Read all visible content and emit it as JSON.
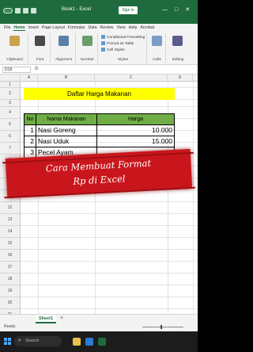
{
  "window": {
    "title": "Book1 - Excel",
    "signin_label": "Sign in",
    "controls": [
      "—",
      "□",
      "✕"
    ]
  },
  "ribbon": {
    "tabs": [
      "File",
      "Home",
      "Insert",
      "Page Layout",
      "Formulas",
      "Data",
      "Review",
      "View",
      "Help",
      "Acrobat"
    ],
    "active_tab": "Home",
    "groups": {
      "clipboard": "Clipboard",
      "font": "Font",
      "alignment": "Alignment",
      "number": "Number",
      "styles": "Styles",
      "cells": "Cells",
      "editing": "Editing"
    },
    "styles_items": [
      "Conditional Formatting",
      "Format as Table",
      "Cell Styles"
    ]
  },
  "formula_bar": {
    "name_box": "D19",
    "fx": "fx",
    "value": ""
  },
  "grid": {
    "columns": [
      "A",
      "B",
      "C",
      "D",
      "E"
    ],
    "rows": [
      "1",
      "2",
      "3",
      "4",
      "5",
      "6",
      "7",
      "8",
      "9",
      "10",
      "11",
      "12",
      "13",
      "14",
      "15",
      "16",
      "17",
      "18",
      "19",
      "20",
      "21"
    ]
  },
  "sheet": {
    "title": "Daftar Harga Makanan",
    "headers": [
      "No",
      "Nama Makanan",
      "Harga"
    ],
    "rows": [
      {
        "no": "1",
        "name": "Nasi Goreng",
        "price": "10.000"
      },
      {
        "no": "2",
        "name": "Nasi Uduk",
        "price": "15.000"
      },
      {
        "no": "3",
        "name": "Pecel Ayam",
        "price": ""
      }
    ]
  },
  "banner": {
    "line1": "Cara Membuat Format",
    "line2": "Rp di Excel"
  },
  "sheet_tabs": {
    "active": "Sheet1",
    "add": "+"
  },
  "status": {
    "ready": "Ready"
  },
  "taskbar": {
    "search_label": "Search"
  },
  "colors": {
    "excel_green": "#1f6b3d",
    "title_fill": "#ffff00",
    "header_fill": "#70ad47",
    "banner_red": "#c9161c"
  }
}
